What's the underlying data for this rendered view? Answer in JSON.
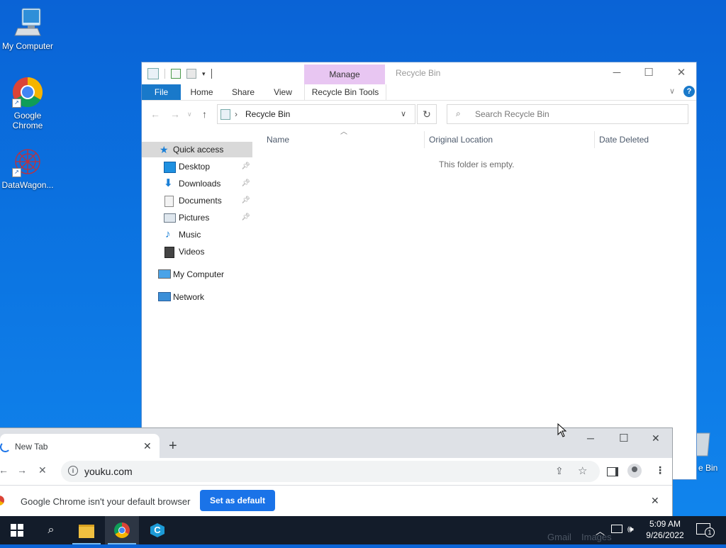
{
  "desktop": {
    "icons": [
      {
        "label": "My Computer",
        "icon": "monitor-icon"
      },
      {
        "label": "Google\nChrome",
        "icon": "chrome-icon"
      },
      {
        "label": "DataWagon...",
        "icon": "datawagon-icon"
      }
    ],
    "recycle_partial_label": "e Bin"
  },
  "explorer": {
    "contextual_tab_group": "Manage",
    "title": "Recycle Bin",
    "ribbon_tabs": [
      "File",
      "Home",
      "Share",
      "View",
      "Recycle Bin Tools"
    ],
    "address_path": "Recycle Bin",
    "search_placeholder": "Search Recycle Bin",
    "nav": {
      "quick_access": "Quick access",
      "items": [
        "Desktop",
        "Downloads",
        "Documents",
        "Pictures",
        "Music",
        "Videos"
      ],
      "my_computer": "My Computer",
      "network": "Network"
    },
    "columns": [
      "Name",
      "Original Location",
      "Date Deleted"
    ],
    "empty_message": "This folder is empty."
  },
  "chrome": {
    "tab_title": "New Tab",
    "url": "youku.com",
    "infobar_message": "Google Chrome isn't your default browser",
    "set_default_label": "Set as default",
    "behind_text": [
      "Gmail",
      "Images"
    ]
  },
  "taskbar": {
    "time": "5:09 AM",
    "date": "9/26/2022",
    "notification_count": "1"
  },
  "colors": {
    "desktop": "#0b72e0",
    "file_tab": "#1979ca",
    "manage_tab": "#e8c6f2",
    "chrome_accent": "#1a73e8",
    "taskbar": "#131c2a"
  }
}
